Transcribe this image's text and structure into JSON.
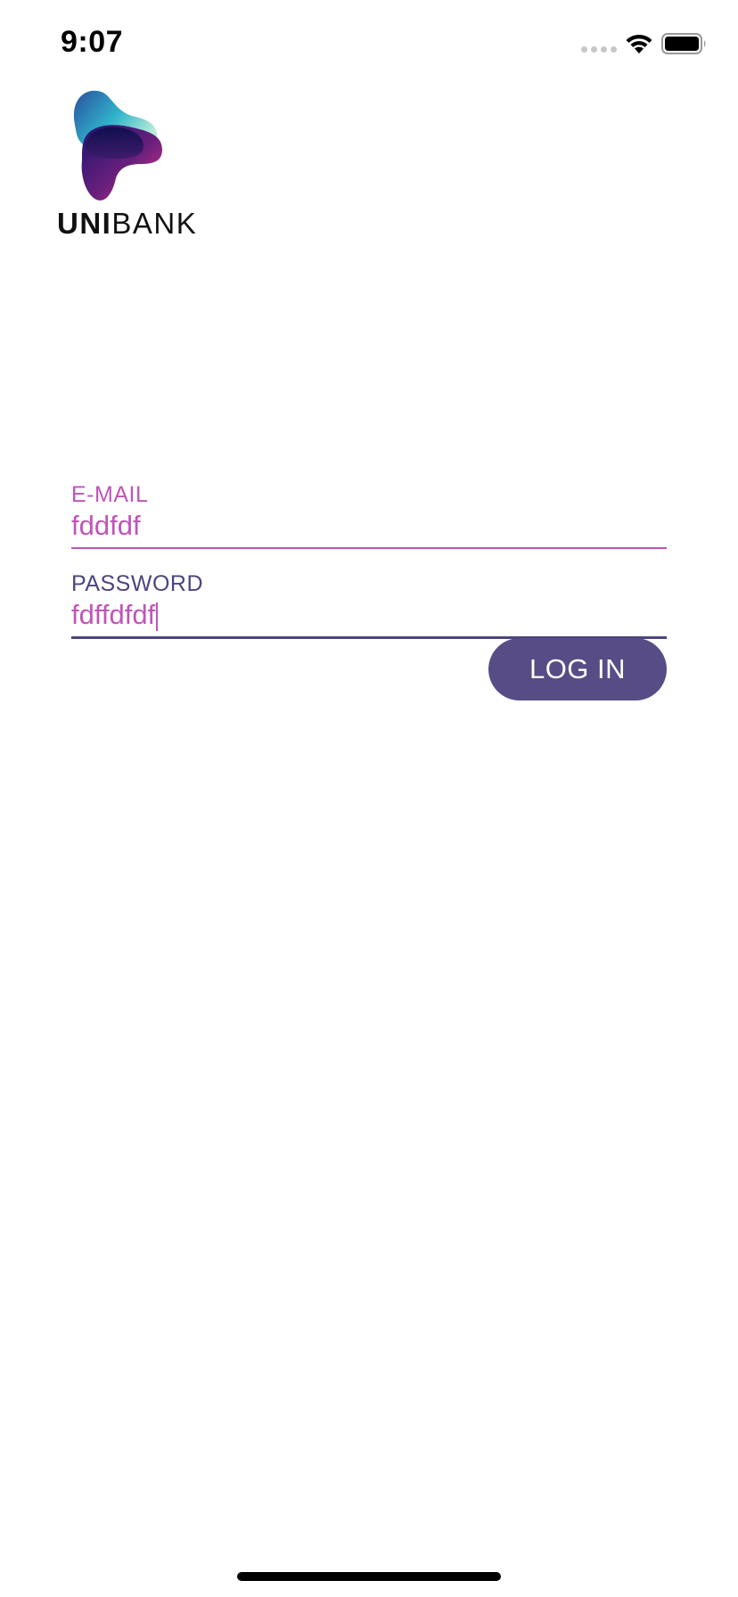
{
  "status_bar": {
    "time": "9:07",
    "wifi_icon": "wifi-icon",
    "battery_icon": "battery-icon"
  },
  "logo": {
    "brand_bold": "UNI",
    "brand_light": "BANK"
  },
  "form": {
    "email": {
      "label": "E-MAIL",
      "value": "fddfdf"
    },
    "password": {
      "label": "PASSWORD",
      "value": "fdffdfdf"
    }
  },
  "login_button": {
    "label": "LOG IN"
  },
  "colors": {
    "accent_pink": "#c055b8",
    "accent_purple": "#574c85",
    "label_purple": "#4b4580"
  }
}
